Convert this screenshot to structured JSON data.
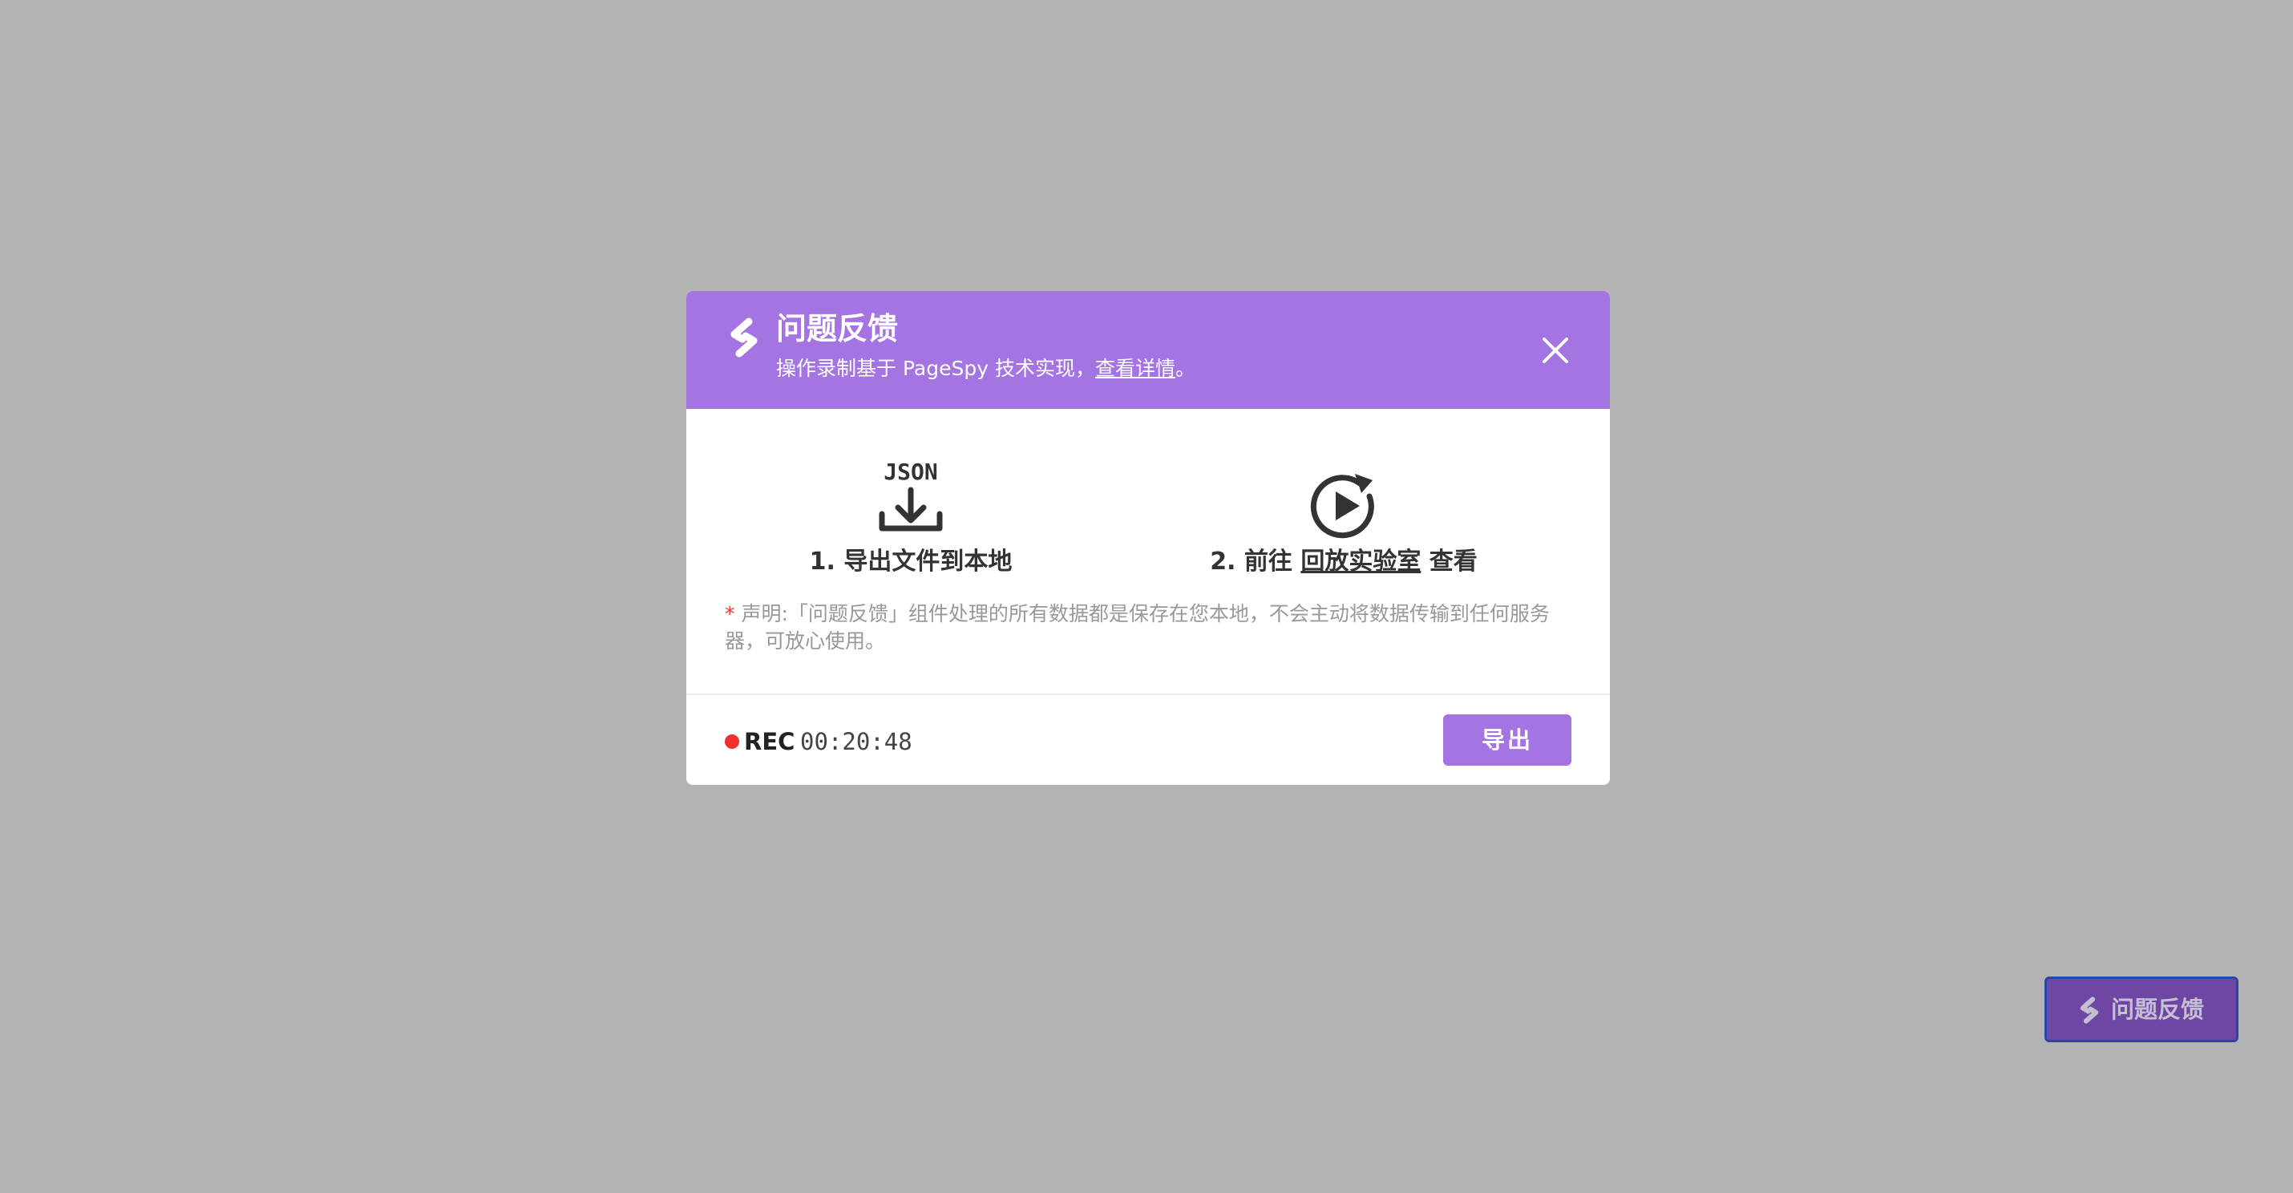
{
  "modal": {
    "title": "问题反馈",
    "subtitle_prefix": "操作录制基于 PageSpy 技术实现，",
    "subtitle_link": "查看详情",
    "subtitle_suffix": "。",
    "steps": [
      {
        "label": "1. 导出文件到本地",
        "icon": "json-download-icon",
        "icon_text": "JSON"
      },
      {
        "label_prefix": "2. 前往 ",
        "label_link": "回放实验室",
        "label_suffix": " 查看",
        "icon": "replay-play-icon"
      }
    ],
    "notice_star": "*",
    "notice": "声明:「问题反馈」组件处理的所有数据都是保存在您本地，不会主动将数据传输到任何服务器，可放心使用。",
    "rec_label": "REC",
    "rec_time": "00:20:48",
    "export_label": "导出"
  },
  "float_button": {
    "label": "问题反馈",
    "icon": "pagespy-logo-icon"
  },
  "colors": {
    "accent": "#a374e2",
    "overlay": "#b3b3b3",
    "rec_dot": "#f0302c",
    "float_bg": "#6d47a3"
  }
}
